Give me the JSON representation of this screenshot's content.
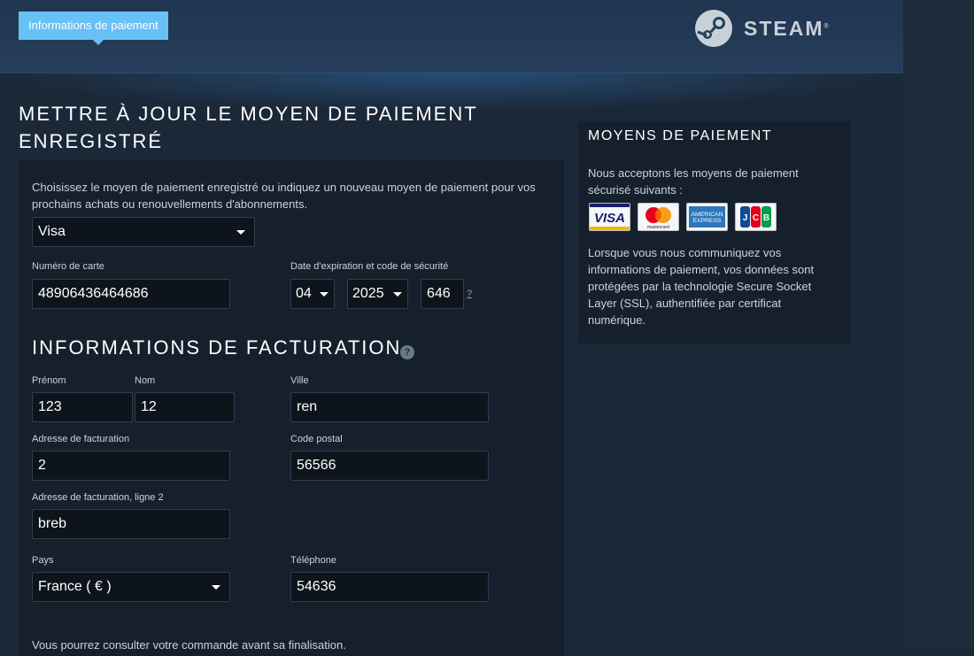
{
  "header": {
    "tab_label": "Informations de paiement",
    "brand": "STEAM"
  },
  "page": {
    "title_line1": "METTRE À JOUR LE MOYEN DE PAIEMENT",
    "title_line2": "ENREGISTRÉ"
  },
  "form": {
    "intro": "Choisissez le moyen de paiement enregistré ou indiquez un nouveau moyen de paiement pour vos prochains achats ou renouvellements d'abonnements.",
    "payment_method": "Visa",
    "card_number_label": "Numéro de carte",
    "card_number": "48906436464686",
    "expiry_label": "Date d'expiration et code de sécurité",
    "expiry_month": "04",
    "expiry_year": "2025",
    "cvv": "646",
    "cvv_help": "?",
    "billing_title": "INFORMATIONS DE FACTURATION",
    "billing_help": "?",
    "first_name_label": "Prénom",
    "first_name": "123",
    "last_name_label": "Nom",
    "last_name": "12",
    "city_label": "Ville",
    "city": "ren",
    "address_label": "Adresse de facturation",
    "address": "2",
    "postal_label": "Code postal",
    "postal": "56566",
    "address2_label": "Adresse de facturation, ligne 2",
    "address2": "breb",
    "country_label": "Pays",
    "country": "France ( € )",
    "phone_label": "Téléphone",
    "phone": "54636",
    "footer_note": "Vous pourrez consulter votre commande avant sa finalisation."
  },
  "sidebar": {
    "title": "MOYENS DE PAIEMENT",
    "accept_text": "Nous acceptons les moyens de paiement sécurisé suivants :",
    "cards": [
      {
        "name": "VISA",
        "icon": "visa-icon"
      },
      {
        "name": "mastercard",
        "icon": "mastercard-icon"
      },
      {
        "name": "AMERICAN EXPRESS",
        "icon": "amex-icon"
      },
      {
        "name": "JCB",
        "icon": "jcb-icon"
      }
    ],
    "ssl_text": "Lorsque vous nous communiquez vos informations de paiement, vos données sont protégées par la technologie Secure Socket Layer (SSL), authentifiée par certificat numérique."
  },
  "colors": {
    "background": "#1b2838",
    "panel": "#16202d",
    "accent": "#67c1f5",
    "input_bg": "#0e141b"
  }
}
